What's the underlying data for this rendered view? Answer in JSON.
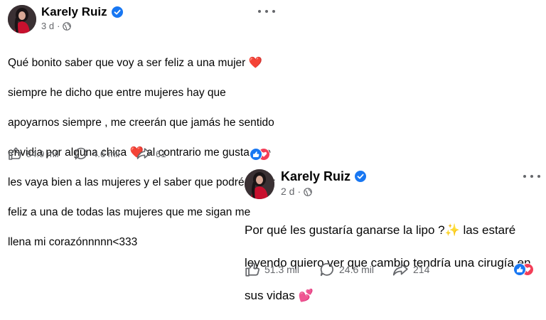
{
  "posts": [
    {
      "author": "Karely Ruiz",
      "time": "3 d",
      "text_lines": [
        "Qué bonito saber que voy a ser feliz a una mujer",
        "siempre he dicho que entre mujeres hay que",
        "apoyarnos siempre , me creerán que jamás he sentido",
        "envidia por alguna chica",
        "les vaya bien a las mujeres y el saber que podré hacer",
        "feliz a una de todas las mujeres que me sigan me",
        "llena mi corazónnnnn<333"
      ],
      "text_line4_rest": "al contrario me gusta que",
      "likes": "84.9 mil",
      "comments": "4.6 mil",
      "shares": "61",
      "icons": [
        "avatar",
        "verified-badge-icon",
        "globe-icon",
        "more-options-icon",
        "heart-emoji",
        "like-icon",
        "comment-icon",
        "share-icon",
        "like-reaction-icon",
        "love-reaction-icon"
      ],
      "colors": {
        "verified": "#1877f2",
        "like": "#1877f2",
        "love": "#f33e58"
      }
    },
    {
      "author": "Karely Ruiz",
      "time": "2 d",
      "text_line1": "Por qué les gustaría ganarse la lipo ?",
      "text_line1_rest": "las estaré",
      "text_line2": "leyendo quiero ver que cambio tendría una cirugía en",
      "text_line3": "sus vidas",
      "likes": "51.3 mil",
      "comments": "24.6 mil",
      "shares": "214",
      "icons": [
        "avatar",
        "verified-badge-icon",
        "globe-icon",
        "more-options-icon",
        "sparkles-emoji",
        "two-hearts-emoji",
        "like-icon",
        "comment-icon",
        "share-icon",
        "like-reaction-icon",
        "love-reaction-icon"
      ]
    }
  ]
}
